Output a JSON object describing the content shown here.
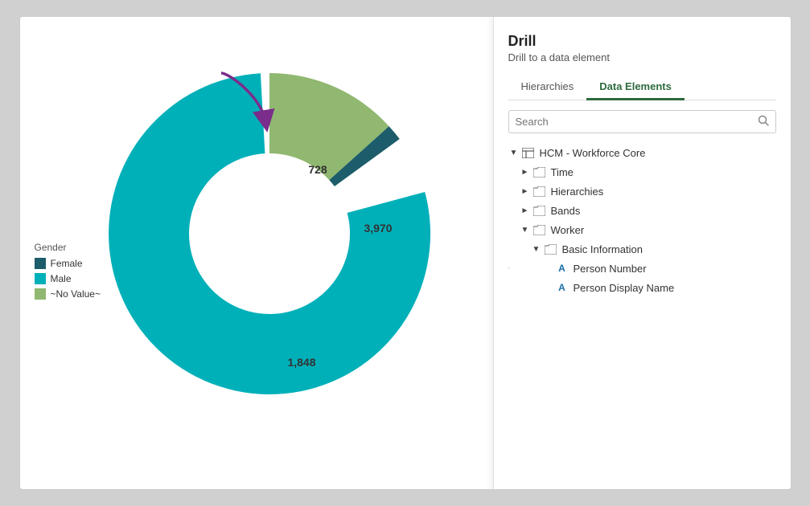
{
  "drill_panel": {
    "title": "Drill",
    "subtitle": "Drill to a data element",
    "tabs": [
      {
        "label": "Hierarchies",
        "active": false
      },
      {
        "label": "Data Elements",
        "active": true
      }
    ],
    "search_placeholder": "Search",
    "tree": [
      {
        "id": "hcm",
        "label": "HCM - Workforce Core",
        "indent": 0,
        "arrow": "down",
        "icon": "table"
      },
      {
        "id": "time",
        "label": "Time",
        "indent": 1,
        "arrow": "right",
        "icon": "folder"
      },
      {
        "id": "hierarchies",
        "label": "Hierarchies",
        "indent": 1,
        "arrow": "right",
        "icon": "folder"
      },
      {
        "id": "bands",
        "label": "Bands",
        "indent": 1,
        "arrow": "right",
        "icon": "folder"
      },
      {
        "id": "worker",
        "label": "Worker",
        "indent": 1,
        "arrow": "down",
        "icon": "folder"
      },
      {
        "id": "basic_info",
        "label": "Basic Information",
        "indent": 2,
        "arrow": "down",
        "icon": "folder"
      },
      {
        "id": "person_number",
        "label": "Person Number",
        "indent": 3,
        "arrow": null,
        "icon": "text"
      },
      {
        "id": "person_display",
        "label": "Person Display Name",
        "indent": 3,
        "arrow": null,
        "icon": "text"
      }
    ]
  },
  "chart": {
    "segments": [
      {
        "label": "Female",
        "color": "#1d5c6b",
        "value": null
      },
      {
        "label": "Male",
        "color": "#00b0b9",
        "value": "3,970"
      },
      {
        "label": "~No Value~",
        "color": "#90b870",
        "value": "728"
      }
    ],
    "inner_label": "1,848"
  },
  "legend": {
    "title": "Gender",
    "items": [
      {
        "label": "Female",
        "color": "#1d5c6b"
      },
      {
        "label": "Male",
        "color": "#00b0b9"
      },
      {
        "label": "~No Value~",
        "color": "#90b870"
      }
    ]
  },
  "arrows": {
    "segment_arrow": "↓",
    "person_arrow": "→"
  }
}
